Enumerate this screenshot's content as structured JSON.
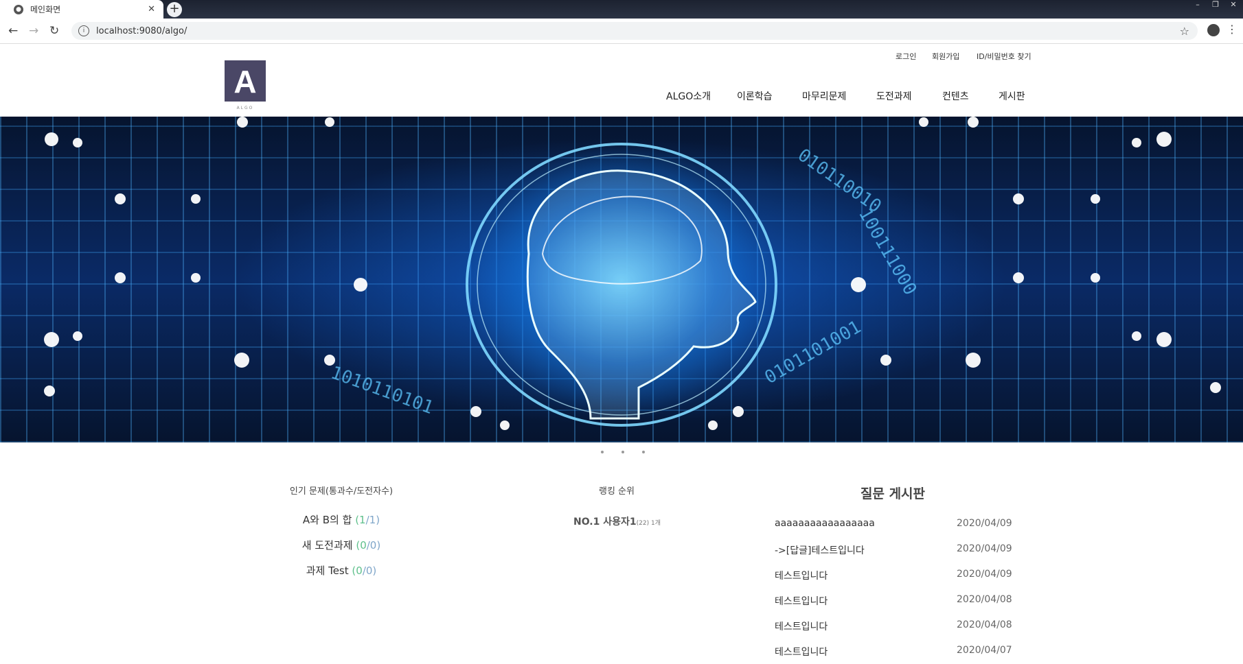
{
  "browser": {
    "tab_title": "메인화면",
    "url": "localhost:9080/algo/"
  },
  "header": {
    "logo_letter": "A",
    "logo_text": "ALGO",
    "util_links": [
      "로그인",
      "회원가입",
      "ID/비밀번호 찾기"
    ],
    "nav": [
      "ALGO소개",
      "이론학습",
      "마무리문제",
      "도전과제",
      "컨텐츠",
      "게시판"
    ]
  },
  "popular": {
    "title": "인기 문제(통과수/도전자수)",
    "items": [
      {
        "name": "A와 B의 합",
        "pass": "(1",
        "total": "/1)"
      },
      {
        "name": "새 도전과제",
        "pass": "(0",
        "total": "/0)"
      },
      {
        "name": "과제 Test",
        "pass": "(0",
        "total": "/0)"
      }
    ]
  },
  "ranking": {
    "title": "랭킹 순위",
    "first": "NO.1 사용자1",
    "detail": "(22) 1개"
  },
  "qa": {
    "title": "질문 게시판",
    "rows": [
      {
        "title": "aaaaaaaaaaaaaaaaa",
        "date": "2020/04/09"
      },
      {
        "title": "->[답글]테스트입니다",
        "date": "2020/04/09"
      },
      {
        "title": "테스트입니다",
        "date": "2020/04/09"
      },
      {
        "title": "테스트입니다",
        "date": "2020/04/08"
      },
      {
        "title": "테스트입니다",
        "date": "2020/04/08"
      },
      {
        "title": "테스트입니다",
        "date": "2020/04/07"
      }
    ]
  }
}
